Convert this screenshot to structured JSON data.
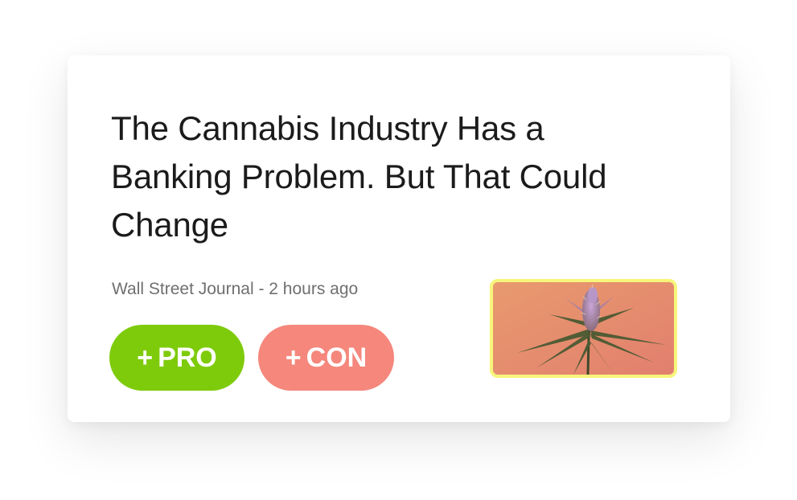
{
  "article": {
    "headline": "The Cannabis Industry Has a Banking Problem. But That Could Change",
    "source": "Wall Street Journal",
    "separator": " - ",
    "time_ago": "2 hours ago",
    "thumbnail_icon": "cannabis-plant-photo"
  },
  "actions": {
    "pro": {
      "plus": "+",
      "label": "PRO"
    },
    "con": {
      "plus": "+",
      "label": "CON"
    }
  },
  "colors": {
    "pro": "#7ecb0c",
    "con": "#f5877c",
    "thumbnail_border": "#f7f57a",
    "headline": "#1b1b1b",
    "meta": "#6f6f6f"
  }
}
